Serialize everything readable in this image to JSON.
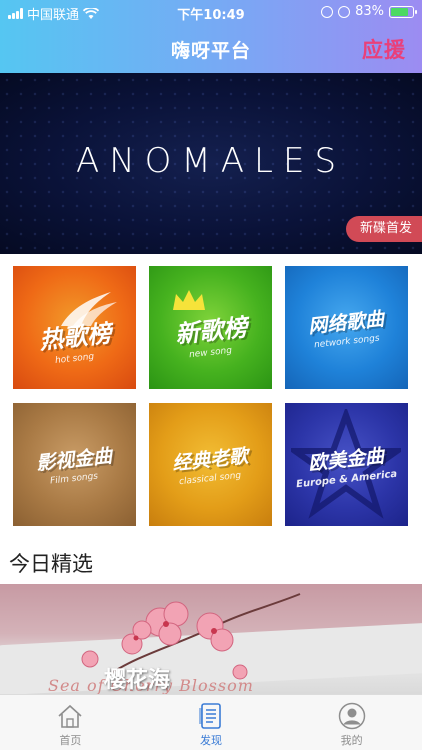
{
  "status_bar": {
    "carrier": "中国联通",
    "time": "下午10:49",
    "battery": "83%",
    "battery_level": 0.83
  },
  "nav": {
    "title": "嗨呀平台",
    "action": "应援"
  },
  "banner": {
    "title": "ANOMALES",
    "badge": "新碟首发"
  },
  "categories": [
    {
      "title": "热歌榜",
      "subtitle": "hot song",
      "color": "#ef6a16"
    },
    {
      "title": "新歌榜",
      "subtitle": "new song",
      "color": "#46b21f"
    },
    {
      "title": "网络歌曲",
      "subtitle": "network songs",
      "color": "#1f82d9"
    },
    {
      "title": "影视金曲",
      "subtitle": "Film songs",
      "color": "#a97a45"
    },
    {
      "title": "经典老歌",
      "subtitle": "classical song",
      "color": "#e39d18"
    },
    {
      "title": "欧美金曲",
      "subtitle": "Europe & America",
      "color": "#2c35a8"
    }
  ],
  "today": {
    "heading": "今日精选",
    "feature": {
      "title": "樱花海",
      "subtitle": "Sea of Cherry Blossom"
    }
  },
  "tabbar": {
    "items": [
      {
        "label": "首页",
        "icon": "home-icon"
      },
      {
        "label": "发现",
        "icon": "discover-icon"
      },
      {
        "label": "我的",
        "icon": "profile-icon"
      }
    ],
    "active_index": 1,
    "active_color": "#3a7bd5",
    "header_gradient": [
      "#55c6f2",
      "#9c8cf2"
    ]
  }
}
